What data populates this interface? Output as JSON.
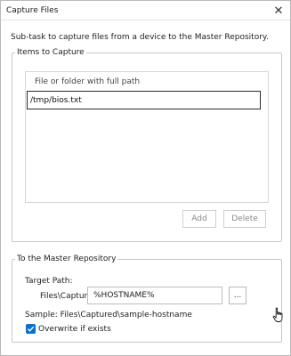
{
  "window": {
    "title": "Capture Files",
    "close_label": "✕"
  },
  "description": "Sub-task to capture files from a device to the Master Repository.",
  "items_group": {
    "legend": "Items to Capture",
    "column_header": "File or folder with full path",
    "path_value": "/tmp/bios.txt",
    "add_label": "Add",
    "delete_label": "Delete"
  },
  "repo_group": {
    "legend": "To the Master Repository",
    "target_label": "Target Path:",
    "target_prefix": "Files\\Captured\\",
    "target_value": "%HOSTNAME%",
    "browse_label": "...",
    "sample_text": "Sample: Files\\Captured\\sample-hostname",
    "overwrite_label": "Overwrite if exists",
    "overwrite_checked": true
  },
  "icons": {
    "close": "close-icon",
    "checkmark": "checkmark-icon",
    "cursor": "hand-pointer-icon"
  },
  "colors": {
    "accent": "#0a72c8",
    "border": "#c8c8c8",
    "disabled_text": "#8a8a8a"
  }
}
